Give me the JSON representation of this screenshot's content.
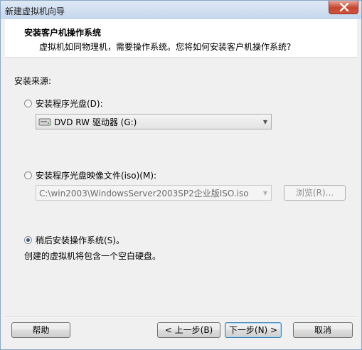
{
  "window": {
    "title": "新建虚拟机向导"
  },
  "header": {
    "title": "安装客户机操作系统",
    "subtitle": "虚拟机如同物理机，需要操作系统。您将如何安装客户机操作系统?"
  },
  "source": {
    "label": "安装来源:",
    "options": [
      {
        "label": "安装程序光盘(D):",
        "selected": false,
        "combo_value": "DVD RW 驱动器 (G:)"
      },
      {
        "label": "安装程序光盘映像文件(iso)(M):",
        "selected": false,
        "combo_value": "C:\\win2003\\WindowsServer2003SP2企业版ISO.iso",
        "browse_label": "浏览(R)..."
      },
      {
        "label": "稍后安装操作系统(S)。",
        "selected": true,
        "description": "创建的虚拟机将包含一个空白硬盘。"
      }
    ]
  },
  "footer": {
    "help_label": "帮助",
    "back_label": "< 上一步(B)",
    "next_label": "下一步(N) >",
    "cancel_label": "取消"
  },
  "icons": {
    "close": "close-icon",
    "disk": "dvd-drive-icon",
    "dropdown": "chevron-down-icon"
  },
  "colors": {
    "title_bar": "#c4d6ec",
    "close_button": "#c7452f",
    "radio_selected": "#2b5797"
  }
}
